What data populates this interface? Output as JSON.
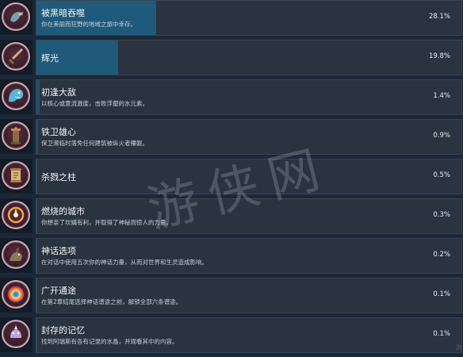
{
  "achievements": [
    {
      "name": "被黑暗吞噬",
      "desc": "你在美丽而狂野的地域之旅中幸存。",
      "percent": "28.1%",
      "fraction": 0.281,
      "icon": "crow-icon"
    },
    {
      "name": "辉光",
      "desc": "",
      "percent": "19.8%",
      "fraction": 0.198,
      "icon": "sword-icon"
    },
    {
      "name": "初逢大敌",
      "desc": "以核心或意流激废，击败浮壑的水元素。",
      "percent": "1.4%",
      "fraction": 0.014,
      "icon": "water-elemental-icon"
    },
    {
      "name": "铁卫雄心",
      "desc": "保卫濒临时落免任何建筑被纵火者攥躯。",
      "percent": "0.9%",
      "fraction": 0.009,
      "icon": "pillar-brazier-icon"
    },
    {
      "name": "杀戮之柱",
      "desc": "",
      "percent": "0.5%",
      "fraction": 0.005,
      "icon": "scroll-icon"
    },
    {
      "name": "燃烧的城市",
      "desc": "你想亲了坎媾有利，并取得了神秘而惊人的力量。",
      "percent": "0.3%",
      "fraction": 0.003,
      "icon": "flame-ring-icon"
    },
    {
      "name": "神话选项",
      "desc": "在对话中使用五次你的神话力量，从而对世界和生灵造成影响。",
      "percent": "0.2%",
      "fraction": 0.002,
      "icon": "creature-icon"
    },
    {
      "name": "广开通途",
      "desc": "在第2章结尾选择神话谱途之前，解锁全部六条谱途。",
      "percent": "0.1%",
      "fraction": 0.001,
      "icon": "rainbow-swirl-icon"
    },
    {
      "name": "封存的记忆",
      "desc": "找到阿瑞斯有各有记录的水晶，并观看其中的内容。",
      "percent": "0.1%",
      "fraction": 0.001,
      "icon": "crystal-creature-icon"
    }
  ],
  "watermark": {
    "text": "游侠网"
  },
  "corner_mark": "游"
}
